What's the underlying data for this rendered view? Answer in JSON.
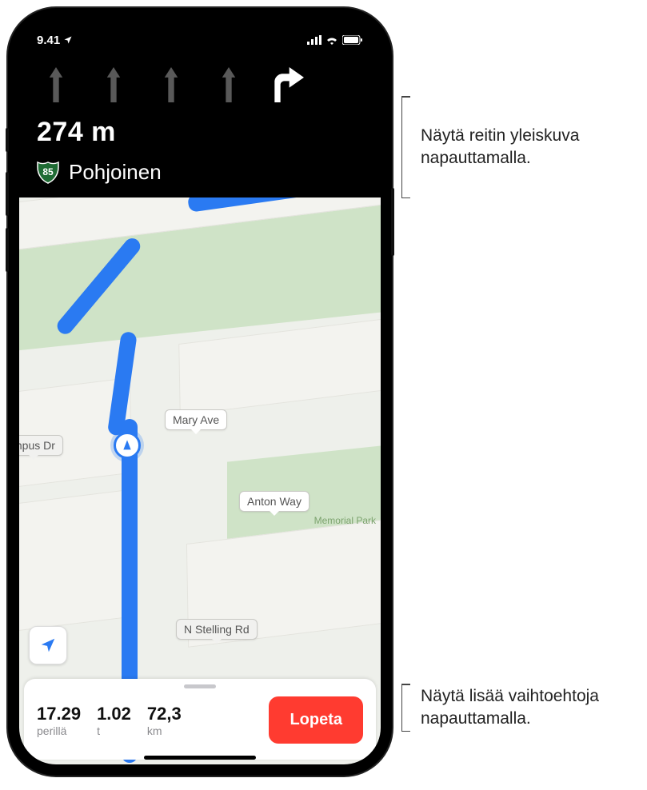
{
  "status": {
    "time": "9.41",
    "locationArrow": "↗"
  },
  "direction": {
    "distance": "274  m",
    "routeShieldNumber": "85",
    "destination": "Pohjoinen",
    "lanes": [
      {
        "type": "straight",
        "active": false
      },
      {
        "type": "straight",
        "active": false
      },
      {
        "type": "straight",
        "active": false
      },
      {
        "type": "straight",
        "active": false
      },
      {
        "type": "right",
        "active": true
      }
    ]
  },
  "map": {
    "labels": [
      {
        "text": "Mary Ave"
      },
      {
        "text": "Anton Way"
      },
      {
        "text": "N Stelling Rd"
      },
      {
        "text": "mpus Dr"
      },
      {
        "text": "Memorial Park"
      }
    ]
  },
  "trip": {
    "eta": {
      "value": "17.29",
      "label": "perillä"
    },
    "duration": {
      "value": "1.02",
      "label": "t"
    },
    "distance": {
      "value": "72,3",
      "label": "km"
    },
    "endButton": "Lopeta"
  },
  "callouts": {
    "topBanner": "Näytä reitin yleiskuva napauttamalla.",
    "bottomCard": "Näytä lisää vaihtoehtoja napauttamalla."
  }
}
